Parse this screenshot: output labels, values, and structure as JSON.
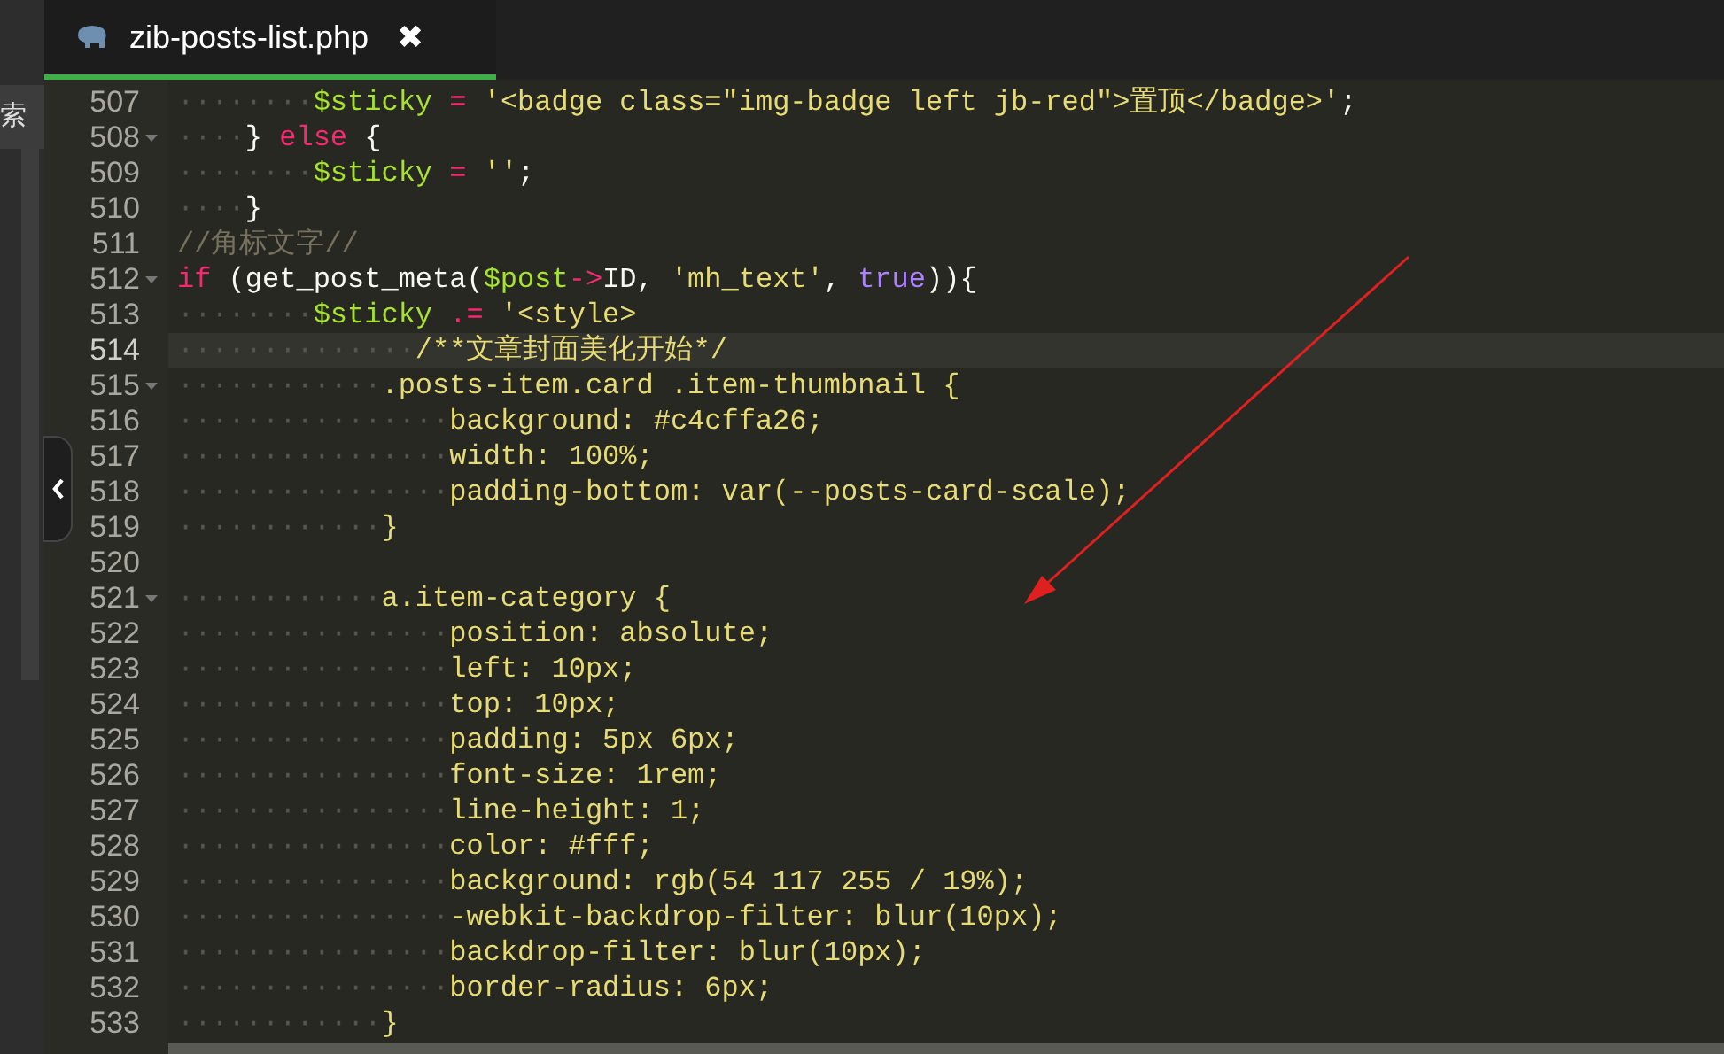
{
  "side_panel": {
    "text": "索"
  },
  "tab": {
    "title": "zib-posts-list.php",
    "close": "✖",
    "selected": true
  },
  "editor": {
    "lines": [
      {
        "number": "507",
        "fold": false,
        "current": false,
        "indent": "········",
        "tokens": [
          {
            "kind": "variable",
            "text": "$sticky"
          },
          {
            "kind": "operator",
            "text": " = "
          },
          {
            "kind": "string",
            "text": "'<badge class=\"img-badge left jb-red\">置顶</badge>'"
          },
          {
            "kind": "plain",
            "text": ";"
          }
        ]
      },
      {
        "number": "508",
        "fold": true,
        "current": false,
        "indent": "····",
        "tokens": [
          {
            "kind": "plain",
            "text": "} "
          },
          {
            "kind": "keyword",
            "text": "else"
          },
          {
            "kind": "plain",
            "text": " {"
          }
        ]
      },
      {
        "number": "509",
        "fold": false,
        "current": false,
        "indent": "········",
        "tokens": [
          {
            "kind": "variable",
            "text": "$sticky"
          },
          {
            "kind": "operator",
            "text": " = "
          },
          {
            "kind": "string",
            "text": "''"
          },
          {
            "kind": "plain",
            "text": ";"
          }
        ]
      },
      {
        "number": "510",
        "fold": false,
        "current": false,
        "indent": "····",
        "tokens": [
          {
            "kind": "plain",
            "text": "}"
          }
        ]
      },
      {
        "number": "511",
        "fold": false,
        "current": false,
        "tokens": [
          {
            "kind": "comment",
            "text": "//角标文字//"
          }
        ]
      },
      {
        "number": "512",
        "fold": true,
        "current": false,
        "tokens": [
          {
            "kind": "keyword",
            "text": "if"
          },
          {
            "kind": "plain",
            "text": " (get_post_meta("
          },
          {
            "kind": "variable",
            "text": "$post"
          },
          {
            "kind": "operator",
            "text": "->"
          },
          {
            "kind": "plain",
            "text": "ID, "
          },
          {
            "kind": "string",
            "text": "'mh_text'"
          },
          {
            "kind": "plain",
            "text": ", "
          },
          {
            "kind": "constant",
            "text": "true"
          },
          {
            "kind": "plain",
            "text": ")){"
          }
        ]
      },
      {
        "number": "513",
        "fold": false,
        "current": false,
        "indent": "········",
        "tokens": [
          {
            "kind": "variable",
            "text": "$sticky"
          },
          {
            "kind": "operator",
            "text": " .= "
          },
          {
            "kind": "string",
            "text": "'<style>"
          }
        ]
      },
      {
        "number": "514",
        "fold": false,
        "current": true,
        "indent": "··············",
        "tokens": [
          {
            "kind": "string",
            "text": "/**文章封面美化开始*/"
          }
        ]
      },
      {
        "number": "515",
        "fold": true,
        "current": false,
        "indent": "············",
        "tokens": [
          {
            "kind": "string",
            "text": ".posts-item.card .item-thumbnail {"
          }
        ]
      },
      {
        "number": "516",
        "fold": false,
        "current": false,
        "indent": "················",
        "tokens": [
          {
            "kind": "string",
            "text": "background: #c4cffa26;"
          }
        ]
      },
      {
        "number": "517",
        "fold": false,
        "current": false,
        "indent": "················",
        "tokens": [
          {
            "kind": "string",
            "text": "width: 100%;"
          }
        ]
      },
      {
        "number": "518",
        "fold": false,
        "current": false,
        "indent": "················",
        "tokens": [
          {
            "kind": "string",
            "text": "padding-bottom: var(--posts-card-scale);"
          }
        ]
      },
      {
        "number": "519",
        "fold": false,
        "current": false,
        "indent": "············",
        "tokens": [
          {
            "kind": "string",
            "text": "}"
          }
        ]
      },
      {
        "number": "520",
        "fold": false,
        "current": false
      },
      {
        "number": "521",
        "fold": true,
        "current": false,
        "indent": "············",
        "tokens": [
          {
            "kind": "string",
            "text": "a.item-category {"
          }
        ]
      },
      {
        "number": "522",
        "fold": false,
        "current": false,
        "indent": "················",
        "tokens": [
          {
            "kind": "string",
            "text": "position: absolute;"
          }
        ]
      },
      {
        "number": "523",
        "fold": false,
        "current": false,
        "indent": "················",
        "tokens": [
          {
            "kind": "string",
            "text": "left: 10px;"
          }
        ]
      },
      {
        "number": "524",
        "fold": false,
        "current": false,
        "indent": "················",
        "tokens": [
          {
            "kind": "string",
            "text": "top: 10px;"
          }
        ]
      },
      {
        "number": "525",
        "fold": false,
        "current": false,
        "indent": "················",
        "tokens": [
          {
            "kind": "string",
            "text": "padding: 5px 6px;"
          }
        ]
      },
      {
        "number": "526",
        "fold": false,
        "current": false,
        "indent": "················",
        "tokens": [
          {
            "kind": "string",
            "text": "font-size: 1rem;"
          }
        ]
      },
      {
        "number": "527",
        "fold": false,
        "current": false,
        "indent": "················",
        "tokens": [
          {
            "kind": "string",
            "text": "line-height: 1;"
          }
        ]
      },
      {
        "number": "528",
        "fold": false,
        "current": false,
        "indent": "················",
        "tokens": [
          {
            "kind": "string",
            "text": "color: #fff;"
          }
        ]
      },
      {
        "number": "529",
        "fold": false,
        "current": false,
        "indent": "················",
        "tokens": [
          {
            "kind": "string",
            "text": "background: rgb(54 117 255 / 19%);"
          }
        ]
      },
      {
        "number": "530",
        "fold": false,
        "current": false,
        "indent": "················",
        "tokens": [
          {
            "kind": "string",
            "text": "-webkit-backdrop-filter: blur(10px);"
          }
        ]
      },
      {
        "number": "531",
        "fold": false,
        "current": false,
        "indent": "················",
        "tokens": [
          {
            "kind": "string",
            "text": "backdrop-filter: blur(10px);"
          }
        ]
      },
      {
        "number": "532",
        "fold": false,
        "current": false,
        "indent": "················",
        "tokens": [
          {
            "kind": "string",
            "text": "border-radius: 6px;"
          }
        ]
      },
      {
        "number": "533",
        "fold": false,
        "current": false,
        "indent": "············",
        "tokens": [
          {
            "kind": "string",
            "text": "}"
          }
        ]
      }
    ]
  }
}
